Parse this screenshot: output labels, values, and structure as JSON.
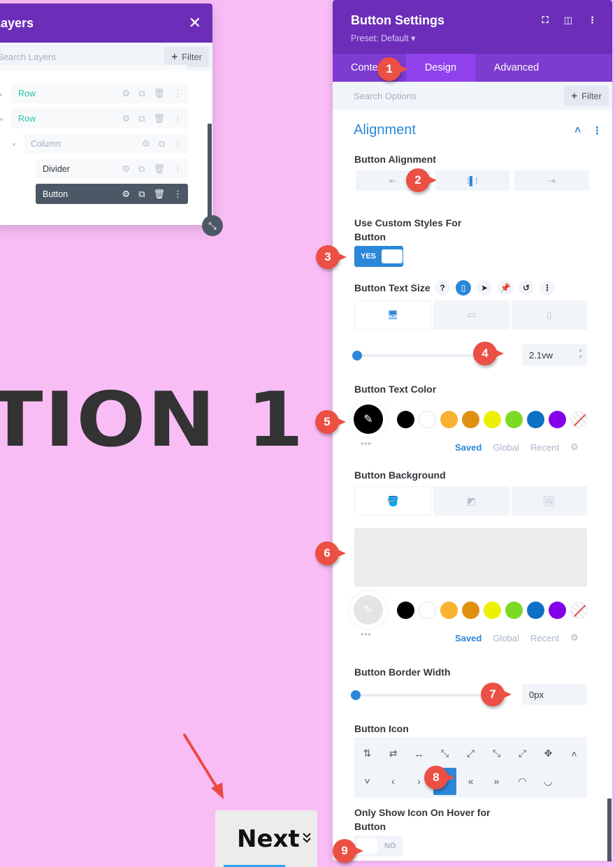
{
  "page": {
    "hero_text": "TION 1",
    "button": {
      "label": "Next",
      "icon": "double-chevron-down-icon",
      "icon_glyph": "≫"
    }
  },
  "layers_panel": {
    "title": "Layers",
    "close_glyph": "✕",
    "search_placeholder": "Search Layers",
    "filter_label": "Filter",
    "items": [
      {
        "label": "Row",
        "type": "row"
      },
      {
        "label": "Row",
        "type": "row"
      },
      {
        "label": "Column",
        "type": "column"
      },
      {
        "label": "Divider",
        "type": "module"
      },
      {
        "label": "Button",
        "type": "module",
        "selected": true
      }
    ]
  },
  "settings_panel": {
    "title": "Button Settings",
    "preset": "Preset: Default ▾",
    "tabs": [
      {
        "label": "Content",
        "active": false
      },
      {
        "label": "Design",
        "active": true
      },
      {
        "label": "Advanced",
        "active": false
      }
    ],
    "search_placeholder": "Search Options",
    "filter_label": "Filter",
    "section_title": "Alignment",
    "button_alignment": {
      "label": "Button Alignment",
      "selected": "center"
    },
    "custom_styles": {
      "label_line1": "Use Custom Styles For",
      "label_line2": "Button",
      "value": "YES"
    },
    "text_size": {
      "label": "Button Text Size",
      "value": "2.1vw",
      "slider_percent": 0
    },
    "text_color": {
      "label": "Button Text Color",
      "current": "#000000",
      "swatches": [
        "#000000",
        "#ffffff",
        "#f8b130",
        "#e0900f",
        "#edf000",
        "#7cda24",
        "#0c71c3",
        "#8300e9"
      ],
      "tabs": [
        "Saved",
        "Global",
        "Recent"
      ],
      "active_tab": "Saved"
    },
    "background": {
      "label": "Button Background",
      "preview_color": "#ececec",
      "swatches": [
        "#000000",
        "#ffffff",
        "#f8b130",
        "#e0900f",
        "#edf000",
        "#7cda24",
        "#0c71c3",
        "#8300e9"
      ],
      "tabs": [
        "Saved",
        "Global",
        "Recent"
      ],
      "active_tab": "Saved"
    },
    "border_width": {
      "label": "Button Border Width",
      "value": "0px",
      "slider_percent": 0
    },
    "button_icon": {
      "label": "Button Icon",
      "icons": [
        "⇅",
        "⇄",
        "↔",
        "⤡",
        "⤢",
        "⤡",
        "⤢",
        "✥",
        "˄",
        "˅",
        "‹",
        "›",
        "︾",
        "«",
        "»",
        "◠",
        "◡"
      ],
      "selected_index": 12
    },
    "hover_icon": {
      "label_line1": "Only Show Icon On Hover for",
      "label_line2": "Button",
      "value": "NO"
    }
  },
  "callouts": [
    "1",
    "2",
    "3",
    "4",
    "5",
    "6",
    "7",
    "8",
    "9"
  ],
  "colors": {
    "header_purple": "#6c2eb9",
    "tab_purple": "#7d3bcf",
    "active_tab": "#8f42ec",
    "accent_blue": "#2b87da",
    "page_bg": "#f9bdf6",
    "callout_red": "#ec4f43"
  }
}
